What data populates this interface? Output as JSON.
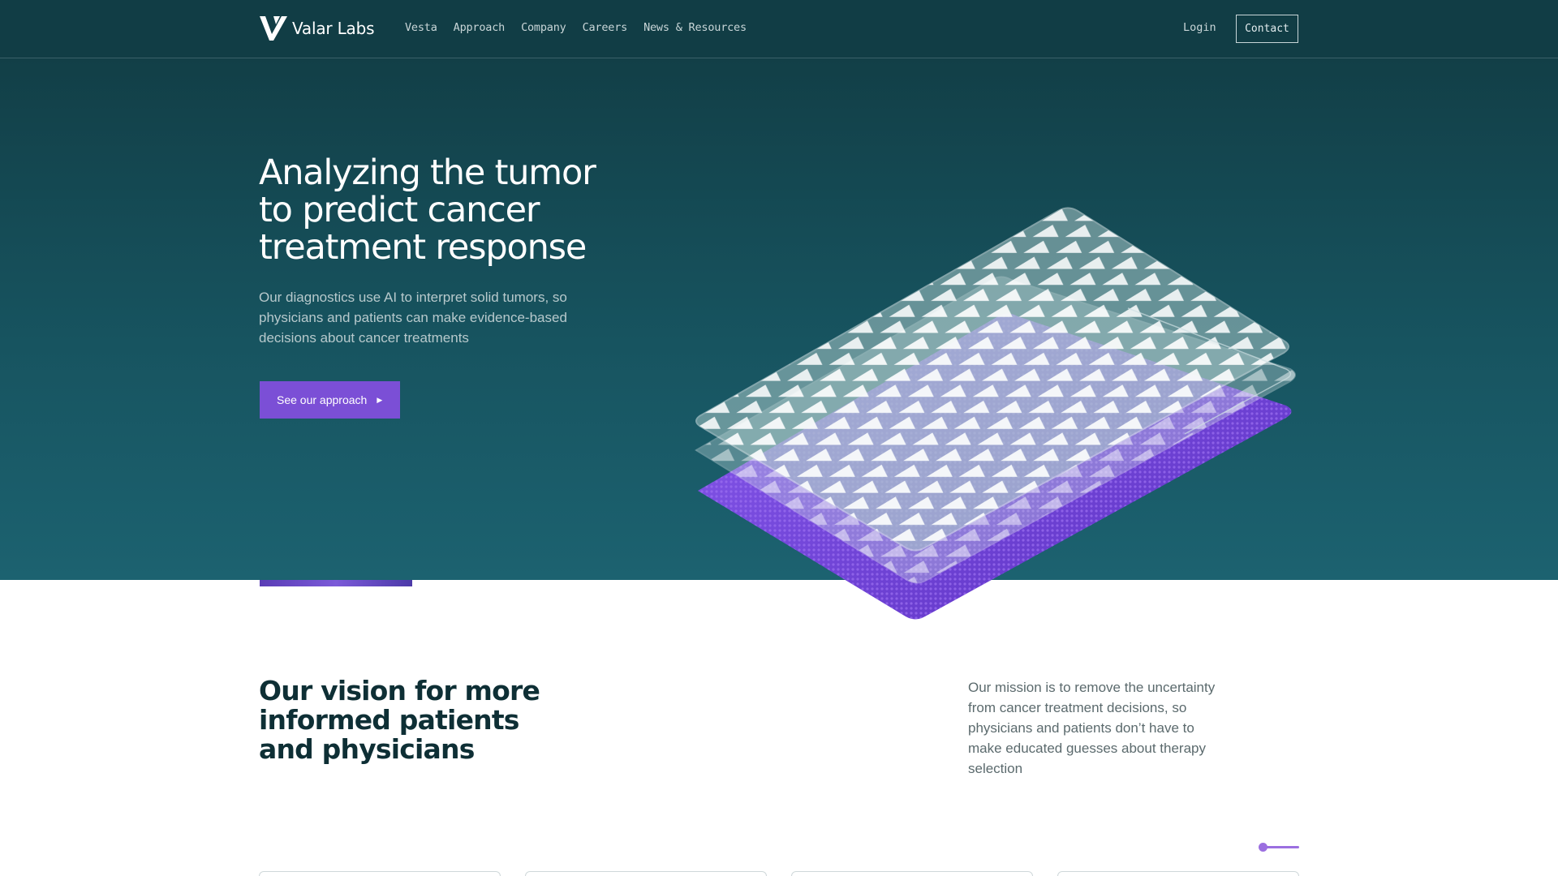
{
  "brand": {
    "name": "Valar Labs"
  },
  "nav": {
    "items": [
      {
        "label": "Vesta"
      },
      {
        "label": "Approach"
      },
      {
        "label": "Company"
      },
      {
        "label": "Careers"
      },
      {
        "label": "News & Resources"
      }
    ],
    "login_label": "Login",
    "contact_label": "Contact"
  },
  "hero": {
    "title": "Analyzing the tumor to predict cancer treatment response",
    "subtitle": "Our diagnostics use AI to interpret solid tumors, so physicians and patients can make evidence-based decisions about cancer treatments",
    "cta_label": "See our approach",
    "cta_icon": "play-arrow-icon"
  },
  "vision": {
    "title": "Our vision for more informed patients and physicians",
    "mission": "Our mission is to remove the uncertainty from cancer treatment decisions, so physicians and patients don’t have to make educated guesses about therapy selection"
  },
  "slider": {
    "position": 0
  },
  "colors": {
    "header_bg": "#113d45",
    "hero_top": "#123f47",
    "hero_bottom": "#1c6270",
    "accent_purple": "#7b4fd6",
    "text_dark": "#0e2f35"
  }
}
